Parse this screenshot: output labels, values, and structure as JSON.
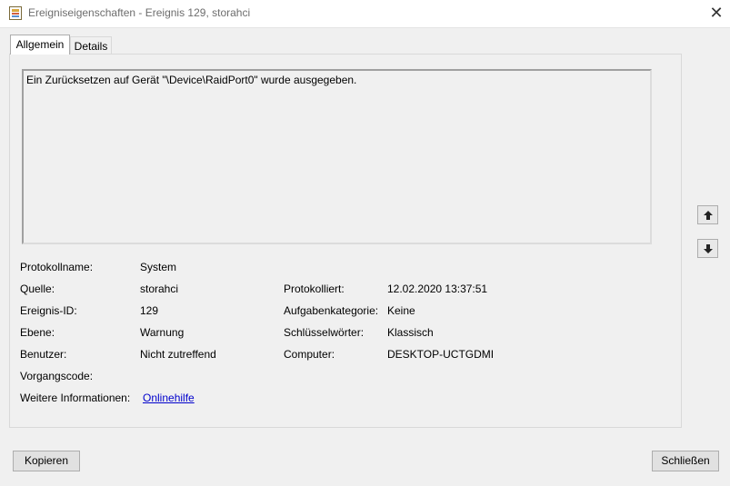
{
  "window": {
    "title": "Ereigniseigenschaften - Ereignis 129, storahci",
    "app_icon": "event-log-icon",
    "close_glyph": "✕"
  },
  "tabs": [
    {
      "label": "Allgemein",
      "active": true
    },
    {
      "label": "Details",
      "active": false
    }
  ],
  "description": "Ein Zurücksetzen auf Gerät \"\\Device\\RaidPort0\" wurde ausgegeben.",
  "fields": {
    "log_name": {
      "label": "Protokollname:",
      "value": "System"
    },
    "source": {
      "label": "Quelle:",
      "value": "storahci"
    },
    "event_id": {
      "label": "Ereignis-ID:",
      "value": "129"
    },
    "level": {
      "label": "Ebene:",
      "value": "Warnung"
    },
    "user": {
      "label": "Benutzer:",
      "value": "Nicht zutreffend"
    },
    "opcode": {
      "label": "Vorgangscode:",
      "value": ""
    },
    "more_info": {
      "label": "Weitere Informationen:",
      "link": "Onlinehilfe"
    },
    "logged": {
      "label": "Protokolliert:",
      "value": "12.02.2020 13:37:51"
    },
    "task_category": {
      "label": "Aufgabenkategorie:",
      "value": "Keine"
    },
    "keywords": {
      "label": "Schlüsselwörter:",
      "value": "Klassisch"
    },
    "computer": {
      "label": "Computer:",
      "value": "DESKTOP-UCTGDMI"
    }
  },
  "nav": {
    "up_glyph": "🡅",
    "down_glyph": "🡇"
  },
  "buttons": {
    "copy": "Kopieren",
    "close": "Schließen"
  },
  "colors": {
    "link": "#0000cc",
    "background": "#f0f0f0"
  }
}
